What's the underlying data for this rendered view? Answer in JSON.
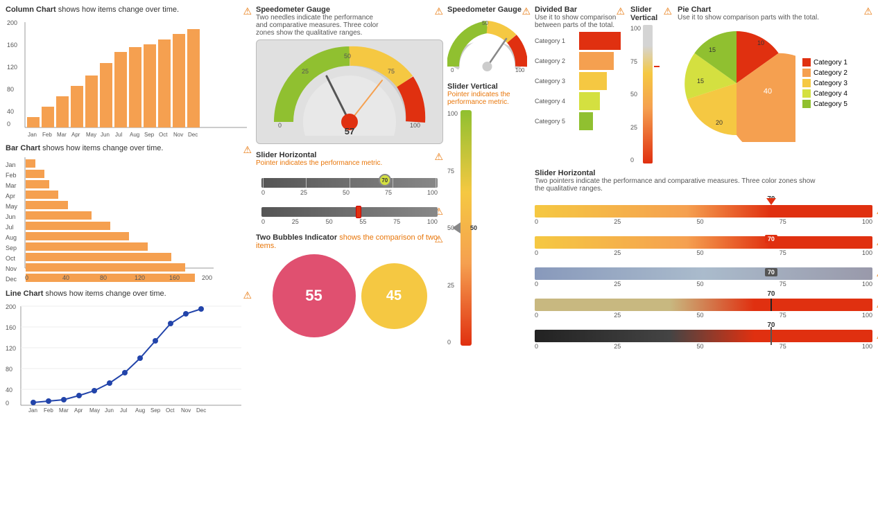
{
  "charts": {
    "columnChart": {
      "title": "Column Chart shows how items change over time.",
      "highlightWord": "Column Chart",
      "months": [
        "Jan",
        "Feb",
        "Mar",
        "Apr",
        "May",
        "Jun",
        "Jul",
        "Aug",
        "Sep",
        "Oct",
        "Nov",
        "Dec"
      ],
      "values": [
        20,
        40,
        60,
        80,
        100,
        125,
        145,
        155,
        160,
        170,
        180,
        190
      ],
      "yLabels": [
        "200",
        "160",
        "120",
        "80",
        "40",
        "0"
      ],
      "warning": "⚠"
    },
    "barChart": {
      "title": "Bar Chart shows how items change over time.",
      "highlightWord": "Bar Chart",
      "months": [
        "Jan",
        "Feb",
        "Mar",
        "Apr",
        "May",
        "Jun",
        "Jul",
        "Aug",
        "Sep",
        "Oct",
        "Nov",
        "Dec"
      ],
      "values": [
        10,
        20,
        25,
        35,
        45,
        70,
        90,
        110,
        130,
        155,
        170,
        180
      ],
      "xLabels": [
        "0",
        "40",
        "80",
        "120",
        "160",
        "200"
      ],
      "warning": "⚠"
    },
    "lineChart": {
      "title": "Line Chart shows how items change over time.",
      "highlightWord": "Line Chart",
      "months": [
        "Jan",
        "Feb",
        "Mar",
        "Apr",
        "May",
        "Jun",
        "Jul",
        "Aug",
        "Sep",
        "Oct",
        "Nov",
        "Dec"
      ],
      "values": [
        5,
        8,
        12,
        20,
        30,
        45,
        65,
        95,
        130,
        165,
        185,
        195
      ],
      "yLabels": [
        "200",
        "160",
        "120",
        "80",
        "40",
        "0"
      ],
      "warning": "⚠"
    },
    "speedometerGauge1": {
      "title": "Speedometer Gauge",
      "desc": "Two needles indicate the performance and comparative measures. Three color zones show the qualitative ranges.",
      "value": 57,
      "warning": "⚠"
    },
    "speedometerGauge2": {
      "title": "Speedometer Gauge",
      "value": 70,
      "warning": "⚠"
    },
    "sliderHorizontal1": {
      "title": "Slider Horizontal",
      "desc": "Pointer indicates the performance metric.",
      "value": 70,
      "labels": [
        "0",
        "25",
        "50",
        "75",
        "100"
      ],
      "warning": "⚠"
    },
    "sliderHorizontal2": {
      "value": 55,
      "labels": [
        "0",
        "25",
        "50",
        "75",
        "100"
      ],
      "warning": "⚠"
    },
    "twoBubbles": {
      "title": "Two Bubbles Indicator",
      "desc": " shows the comparison of two items.",
      "value1": 55,
      "value2": 45,
      "warning": "⚠"
    },
    "sliderVerticalLeft": {
      "title": "Slider Vertical",
      "desc": "Pointer indicates the performance metric.",
      "value": 50,
      "labels": [
        "100",
        "75",
        "50",
        "25",
        "0"
      ],
      "warning": "⚠"
    },
    "dividedBar": {
      "title": "Divided Bar",
      "desc": "Use it to show comparison between parts of the total.",
      "categories": [
        "Category 1",
        "Category 2",
        "Category 3",
        "Category 4",
        "Category 5"
      ],
      "colors": [
        "#e03010",
        "#f5a050",
        "#f5c842",
        "#d4e040",
        "#90c030"
      ],
      "widths": [
        60,
        50,
        40,
        30,
        20
      ],
      "warning": "⚠"
    },
    "sliderVerticalRight": {
      "title": "Slider Vertical",
      "value": 70,
      "yLabels": [
        "100",
        "75",
        "50",
        "25",
        "0"
      ],
      "warning": "⚠"
    },
    "pieChart": {
      "title": "Pie Chart",
      "desc": "Use it to show comparison parts with the total.",
      "categories": [
        "Category 1",
        "Category 2",
        "Category 3",
        "Category 4",
        "Category 5"
      ],
      "values": [
        10,
        40,
        20,
        15,
        15
      ],
      "colors": [
        "#e03010",
        "#f5a050",
        "#f5c842",
        "#d4e040",
        "#90c030"
      ],
      "warning": "⚠"
    },
    "sliderHRight": {
      "title": "Slider Horizontal",
      "desc": "Two pointers indicate the performance and comparative measures. Three color zones show the qualitative ranges.",
      "rows": [
        {
          "value": 70,
          "type": "arrow-top",
          "colors": "orange-red"
        },
        {
          "value": 70,
          "type": "box-label",
          "colors": "orange-red"
        },
        {
          "value": 70,
          "type": "box-label-gray",
          "colors": "gray"
        },
        {
          "value": 70,
          "type": "arrow-top-line",
          "colors": "tan-red"
        },
        {
          "value": 70,
          "type": "line-label",
          "colors": "black-red"
        }
      ],
      "labels": [
        "0",
        "25",
        "50",
        "75",
        "100"
      ],
      "warning": "⚠"
    }
  }
}
